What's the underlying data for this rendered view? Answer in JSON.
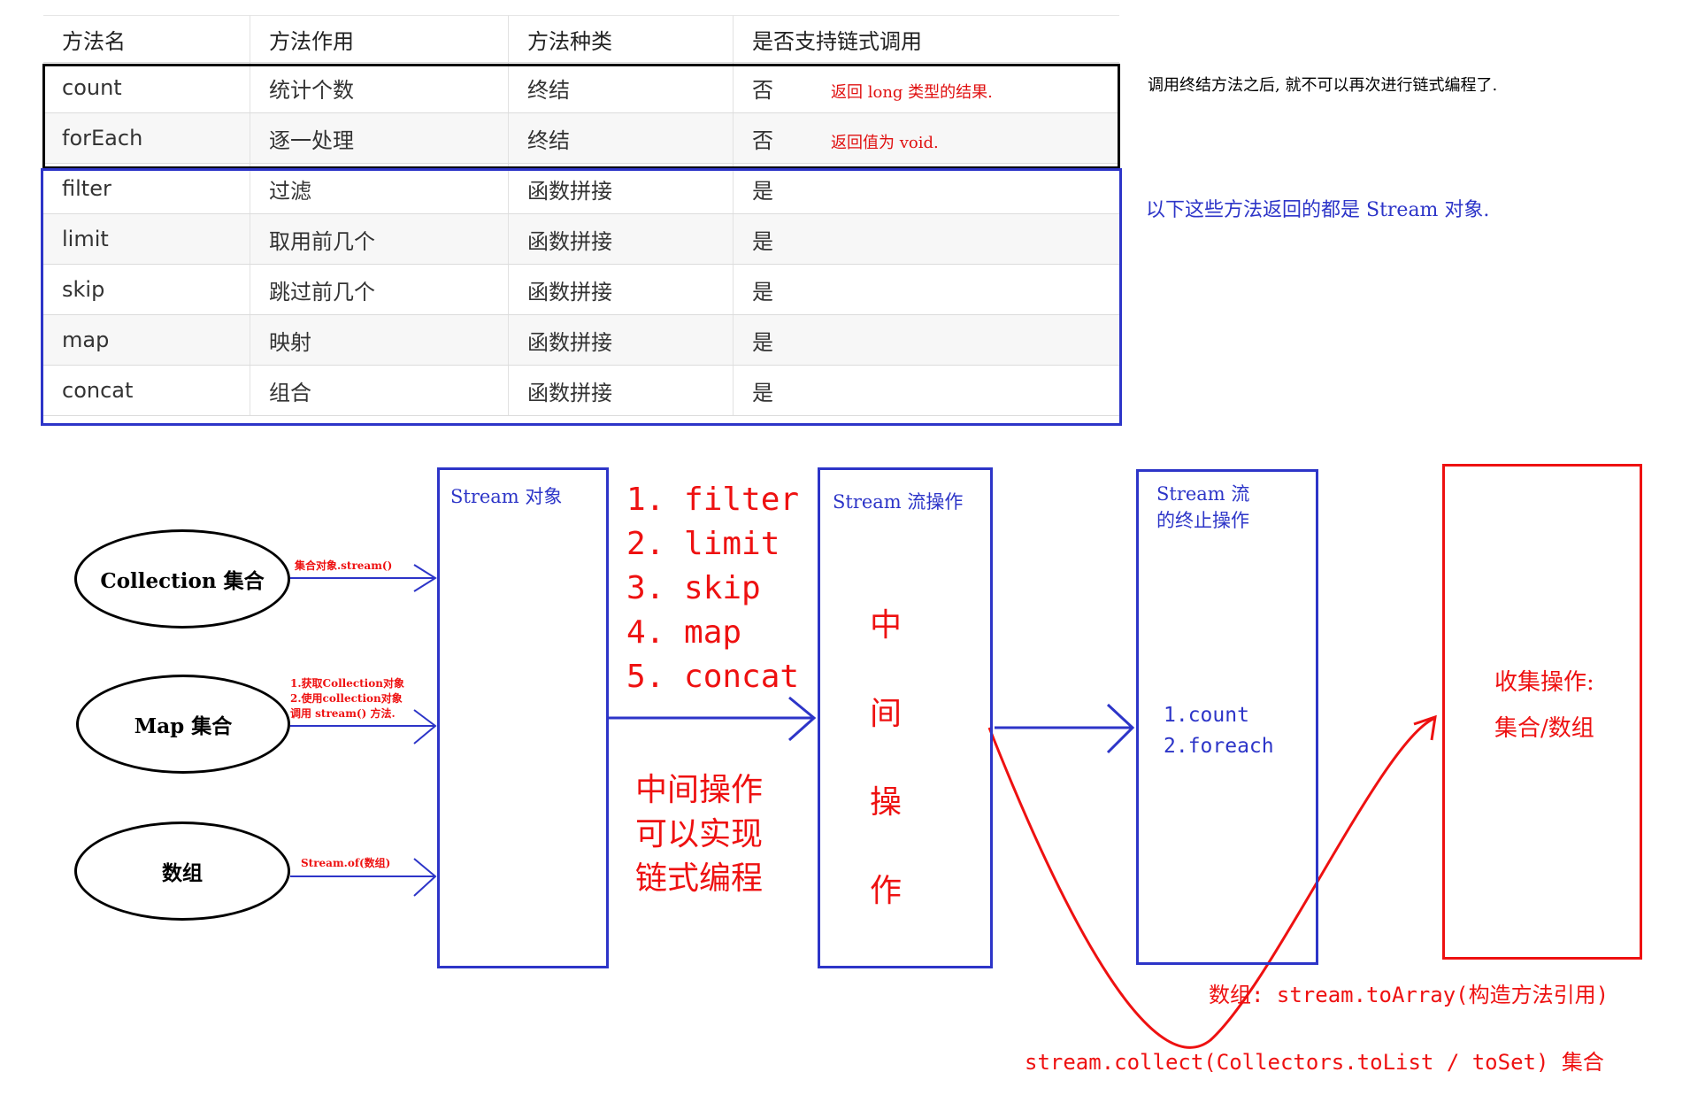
{
  "table": {
    "headers": [
      "方法名",
      "方法作用",
      "方法种类",
      "是否支持链式调用"
    ],
    "rows": [
      {
        "name": "count",
        "purpose": "统计个数",
        "kind": "终结",
        "chain": "否",
        "note": "返回 long 类型的结果."
      },
      {
        "name": "forEach",
        "purpose": "逐一处理",
        "kind": "终结",
        "chain": "否",
        "note": "返回值为 void."
      },
      {
        "name": "filter",
        "purpose": "过滤",
        "kind": "函数拼接",
        "chain": "是",
        "note": ""
      },
      {
        "name": "limit",
        "purpose": "取用前几个",
        "kind": "函数拼接",
        "chain": "是",
        "note": ""
      },
      {
        "name": "skip",
        "purpose": "跳过前几个",
        "kind": "函数拼接",
        "chain": "是",
        "note": ""
      },
      {
        "name": "map",
        "purpose": "映射",
        "kind": "函数拼接",
        "chain": "是",
        "note": ""
      },
      {
        "name": "concat",
        "purpose": "组合",
        "kind": "函数拼接",
        "chain": "是",
        "note": ""
      }
    ]
  },
  "notes": {
    "terminal": "调用终结方法之后, 就不可以再次进行链式编程了.",
    "stream_return": "以下这些方法返回的都是 Stream 对象."
  },
  "sources": {
    "collection": "Collection 集合",
    "map": "Map 集合",
    "array": "数组"
  },
  "source_labels": {
    "collection": "集合对象.stream()",
    "map_line1": "1.获取Collection对象",
    "map_line2": "2.使用collection对象",
    "map_line3": "调用 stream() 方法.",
    "array": "Stream.of(数组)"
  },
  "stream_box": {
    "title": "Stream 对象"
  },
  "methods_list": [
    "1. filter",
    "2. limit",
    "3. skip",
    "4. map",
    "5. concat"
  ],
  "middle_note": [
    "中间操作",
    "可以实现",
    "链式编程"
  ],
  "ops_box": {
    "title": "Stream 流操作",
    "chars": [
      "中",
      "间",
      "操",
      "作"
    ]
  },
  "terminal_box": {
    "title_line1": "Stream 流",
    "title_line2": "的终止操作",
    "items": [
      "1.count",
      "2.foreach"
    ]
  },
  "collect_box": {
    "line1": "收集操作:",
    "line2": "集合/数组"
  },
  "bottom_notes": {
    "array": "数组: stream.toArray(构造方法引用)",
    "collection": "stream.collect(Collectors.toList / toSet) 集合"
  },
  "colors": {
    "blue": "#2d35c8",
    "red": "#ee1111",
    "black": "#000000"
  }
}
